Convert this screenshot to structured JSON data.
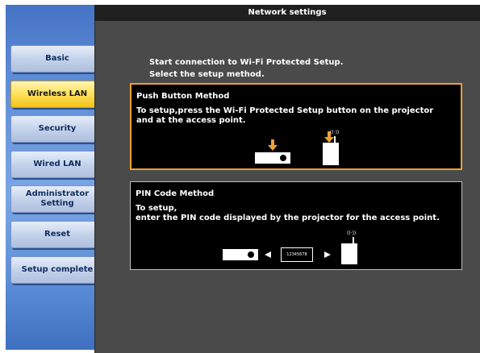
{
  "window": {
    "title": "Network settings"
  },
  "sidebar": {
    "items": [
      {
        "label": "Basic"
      },
      {
        "label": "Wireless LAN"
      },
      {
        "label": "Security"
      },
      {
        "label": "Wired LAN"
      },
      {
        "label": "Administrator Setting"
      },
      {
        "label": "Reset"
      },
      {
        "label": "Setup complete"
      }
    ],
    "active": "Wireless LAN"
  },
  "main": {
    "intro_line1": "Start connection to Wi-Fi Protected Setup.",
    "intro_line2": "Select the setup method.",
    "push_button_method": {
      "title": "Push Button Method",
      "desc_line1": "To setup,press the Wi-Fi Protected Setup button on the projector",
      "desc_line2": "and at the access point.",
      "signal": "((·))"
    },
    "pin_code_method": {
      "title": "PIN Code Method",
      "desc_line1": "To setup,",
      "desc_line2": "enter the PIN code displayed by the projector for the access point.",
      "pin": "12345678",
      "signal": "((·))"
    }
  },
  "colors": {
    "selected_border": "#f0a030",
    "active_nav": "#ffe05a",
    "sidebar": "#5c8bd7",
    "panel": "#4a4a4a"
  },
  "icons": [
    "projector-icon",
    "access-point-icon",
    "push-arrow-icon",
    "wireless-signal-icon",
    "arrow-left-icon",
    "arrow-right-icon"
  ]
}
